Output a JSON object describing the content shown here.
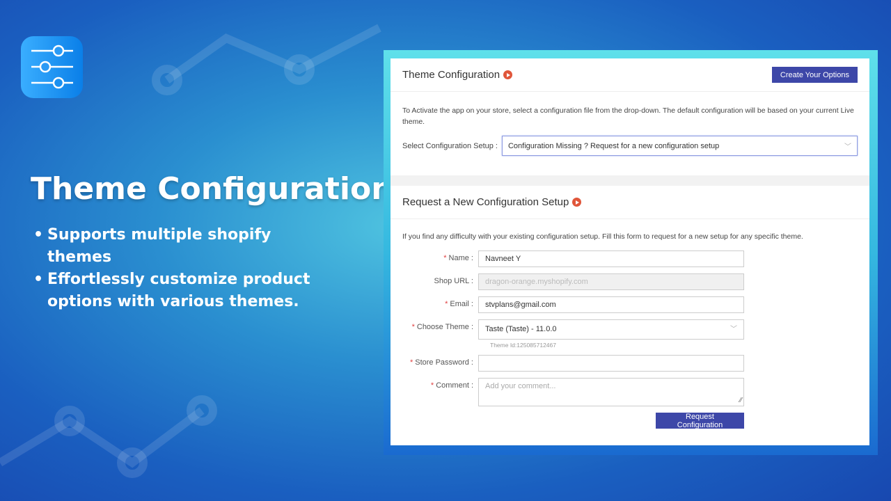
{
  "hero": {
    "title": "Theme Configuration",
    "bullets": [
      "Supports multiple shopify themes",
      "Effortlessly customize product options with various themes."
    ]
  },
  "icons": {
    "logo": "sliders-icon",
    "video": "play-icon"
  },
  "colors": {
    "accent": "#3d47a8",
    "play": "#e0563a"
  },
  "section1": {
    "title": "Theme Configuration",
    "button": "Create Your Options",
    "description": "To Activate the app on your store, select a configuration file from the drop-down. The default configuration will be based on your current Live theme.",
    "select_label": "Select Configuration Setup :",
    "select_value": "Configuration Missing ? Request for a new configuration setup"
  },
  "section2": {
    "title": "Request a New Configuration Setup",
    "description": "If you find any difficulty with your existing configuration setup. Fill this form to request for a new setup for any specific theme.",
    "fields": {
      "name_label": "Name :",
      "name_value": "Navneet Y",
      "shop_label": "Shop URL :",
      "shop_value": "dragon-orange.myshopify.com",
      "email_label": "Email :",
      "email_value": "stvplans@gmail.com",
      "theme_label": "Choose Theme :",
      "theme_value": "Taste (Taste) - 11.0.0",
      "theme_id": "Theme Id:125085712467",
      "password_label": "Store Password :",
      "password_value": "",
      "comment_label": "Comment :",
      "comment_placeholder": "Add your comment..."
    },
    "submit": "Request Configuration"
  }
}
